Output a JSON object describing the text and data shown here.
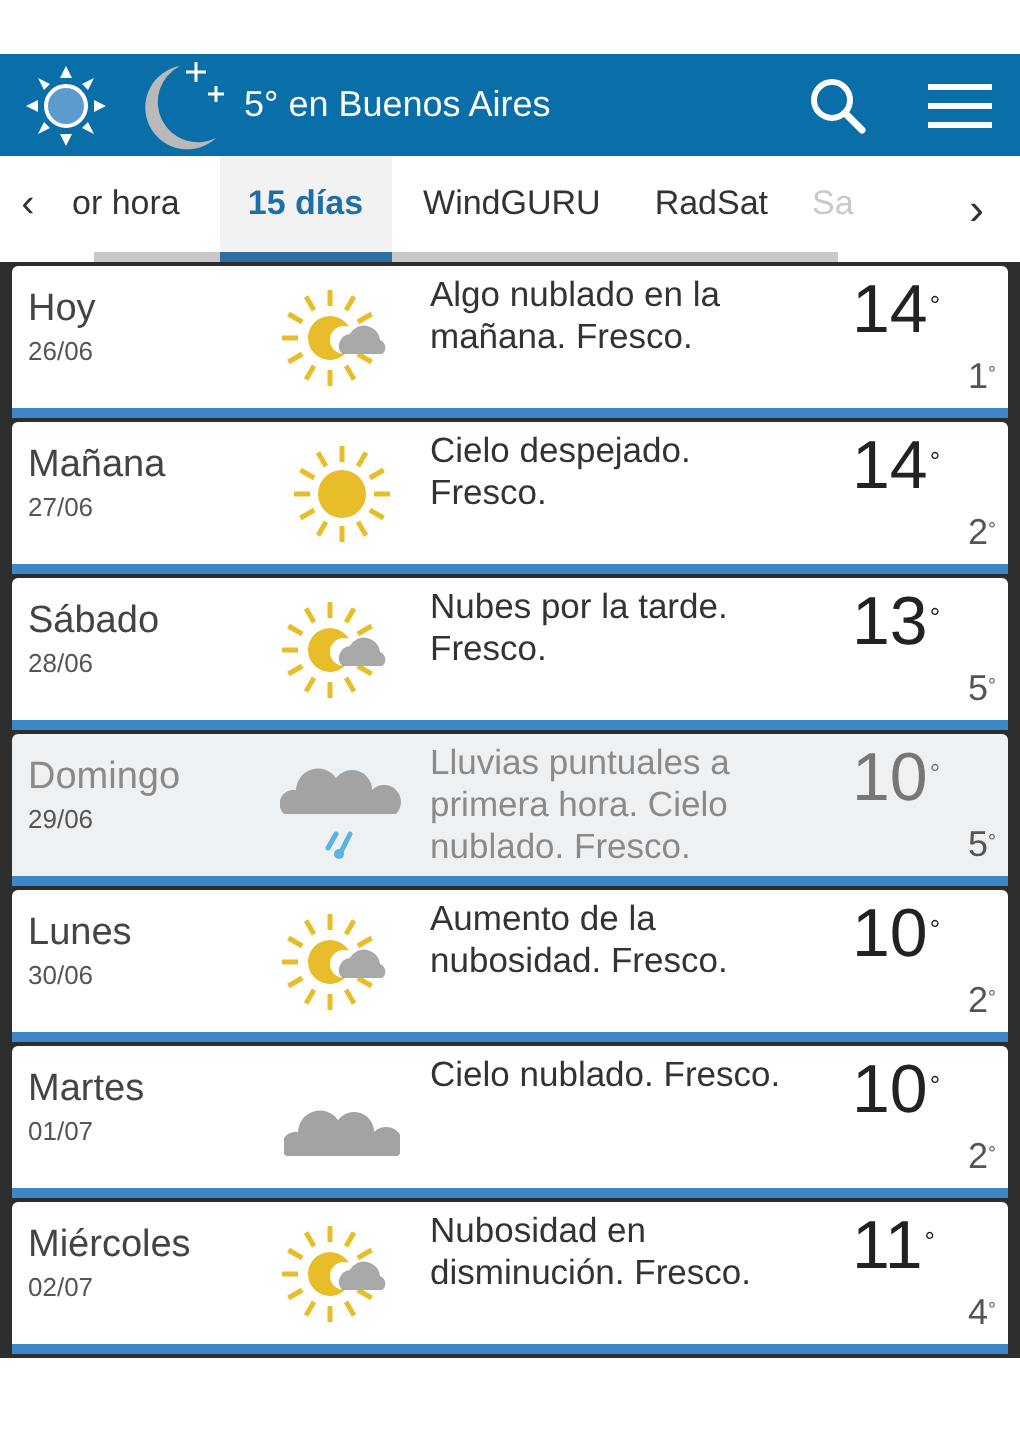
{
  "header": {
    "title": "5° en Buenos Aires"
  },
  "tab_scroll": {
    "left": "‹",
    "right": "›"
  },
  "tabs": [
    {
      "label": "or hora",
      "selected": false,
      "faded": false
    },
    {
      "label": "15 días",
      "selected": true,
      "faded": false
    },
    {
      "label": "WindGURU",
      "selected": false,
      "faded": false
    },
    {
      "label": "RadSat",
      "selected": false,
      "faded": false
    },
    {
      "label": "Sa",
      "selected": false,
      "faded": true
    }
  ],
  "days": [
    {
      "day": "Hoy",
      "date": "26/06",
      "kind": "sun-cloud",
      "description": "Algo nublado en la mañana. Fresco.",
      "max": "14",
      "max_unit": "°",
      "min": "1",
      "min_unit": "°",
      "dimmed": false
    },
    {
      "day": "Mañana",
      "date": "27/06",
      "kind": "sun",
      "description": "Cielo despejado. Fresco.",
      "max": "14",
      "max_unit": "°",
      "min": "2",
      "min_unit": "°",
      "dimmed": false
    },
    {
      "day": "Sábado",
      "date": "28/06",
      "kind": "sun-cloud",
      "description": "Nubes por la tarde. Fresco.",
      "max": "13",
      "max_unit": "°",
      "min": "5",
      "min_unit": "°",
      "dimmed": false
    },
    {
      "day": "Domingo",
      "date": "29/06",
      "kind": "rain",
      "description": "Lluvias puntuales a primera hora. Cielo nublado. Fresco.",
      "max": "10",
      "max_unit": "°",
      "min": "5",
      "min_unit": "°",
      "dimmed": true
    },
    {
      "day": "Lunes",
      "date": "30/06",
      "kind": "sun-cloud",
      "description": "Aumento de la nubosidad. Fresco.",
      "max": "10",
      "max_unit": "°",
      "min": "2",
      "min_unit": "°",
      "dimmed": false
    },
    {
      "day": "Martes",
      "date": "01/07",
      "kind": "cloud",
      "description": "Cielo nublado. Fresco.",
      "max": "10",
      "max_unit": "°",
      "min": "2",
      "min_unit": "°",
      "dimmed": false
    },
    {
      "day": "Miércoles",
      "date": "02/07",
      "kind": "sun-cloud",
      "description": "Nubosidad en disminución. Fresco.",
      "max": "11",
      "max_unit": "°",
      "min": "4",
      "min_unit": "°",
      "dimmed": false
    }
  ]
}
